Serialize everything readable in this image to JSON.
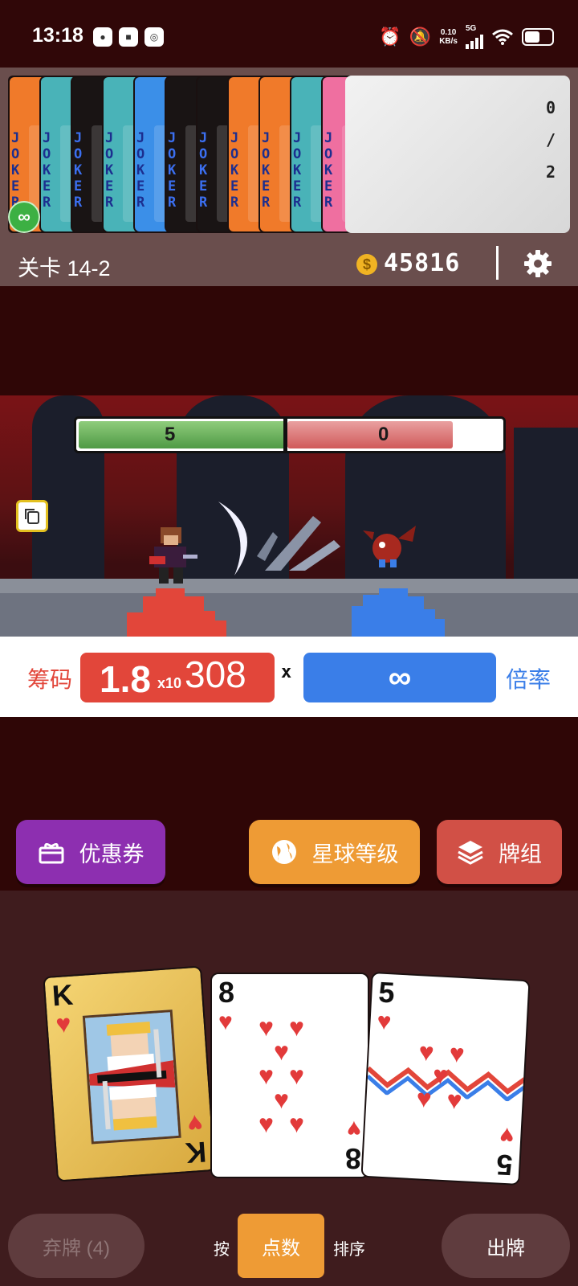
{
  "status_bar": {
    "time": "13:18",
    "net_speed_value": "0.10",
    "net_speed_unit": "KB/s",
    "network": "5G",
    "icons": [
      "alarm-icon",
      "mute-icon",
      "signal-icon",
      "wifi-icon",
      "battery-icon"
    ],
    "battery_level": 0.45
  },
  "joker_strip": {
    "card_text": "JOKER",
    "card_colors": [
      "#f07a2a",
      "#49b3b8",
      "#191414",
      "#49b3b8",
      "#3b8fe8",
      "#191414",
      "#191414",
      "#f07a2a",
      "#f07a2a",
      "#49b3b8",
      "#ef6fa0"
    ],
    "slot_counter": "0/2",
    "slot_counter_chars": [
      "0",
      "/",
      "2"
    ],
    "infinity_badge": "∞"
  },
  "header": {
    "level": "关卡 14-2",
    "coins": "45816",
    "coin_symbol": "$"
  },
  "battle": {
    "player_hp": "5",
    "enemy_hp": "0",
    "player_hp_fraction": 0.5,
    "enemy_hp_fraction": 0.4
  },
  "score": {
    "chips_label": "筹码",
    "chips_mantissa": "1.8",
    "chips_x10": "x10",
    "chips_exponent": "308",
    "times_sign": "x",
    "mult_value": "∞",
    "mult_label": "倍率"
  },
  "actions": {
    "coupon": "优惠券",
    "planet_level": "星球等级",
    "deck": "牌组"
  },
  "hand": [
    {
      "rank": "K",
      "suit": "hearts"
    },
    {
      "rank": "8",
      "suit": "hearts"
    },
    {
      "rank": "5",
      "suit": "hearts"
    }
  ],
  "controls": {
    "discard": "弃牌 (4)",
    "sort_prefix": "按",
    "sort_active": "点数",
    "sort_suffix": "排序",
    "play": "出牌"
  },
  "colors": {
    "chips_red": "#e2463a",
    "mult_blue": "#3a7ee8",
    "coupon_purple": "#8d2fb0",
    "planet_orange": "#ee9b35",
    "deck_red": "#d15046"
  }
}
